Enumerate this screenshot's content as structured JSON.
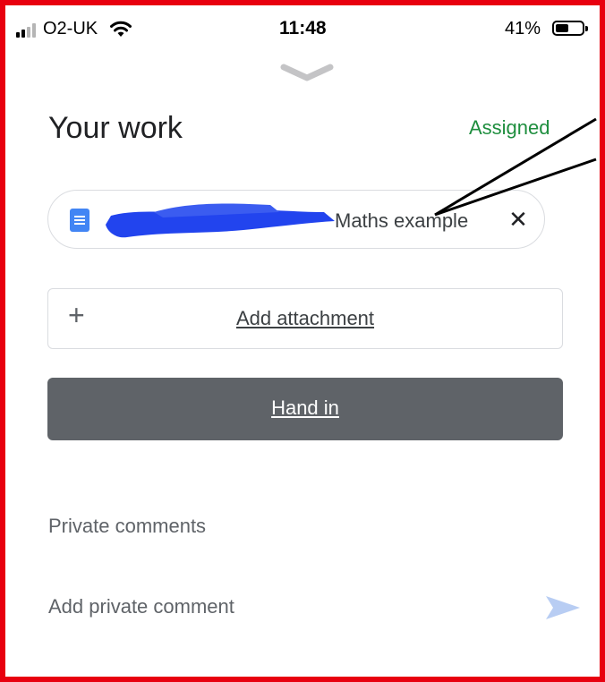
{
  "status_bar": {
    "carrier": "O2-UK",
    "time": "11:48",
    "battery_percent": "41%",
    "battery_level": 0.41,
    "signal_bars": 2,
    "signal_total": 4
  },
  "sheet": {
    "title": "Your work",
    "status": "Assigned",
    "status_color": "#1e8e3e"
  },
  "attachment": {
    "file_name": "Maths example",
    "file_icon": "google-docs-icon",
    "remove_icon": "close-icon"
  },
  "add_attachment": {
    "label": "Add attachment",
    "icon": "plus-icon"
  },
  "hand_in": {
    "label": "Hand in",
    "color": "#5f6368"
  },
  "private_comments": {
    "heading": "Private comments",
    "placeholder": "Add private comment",
    "send_icon": "send-icon"
  },
  "colors": {
    "frame": "#e8000f",
    "redaction": "#2244ee",
    "send": "#b8cdf3"
  }
}
